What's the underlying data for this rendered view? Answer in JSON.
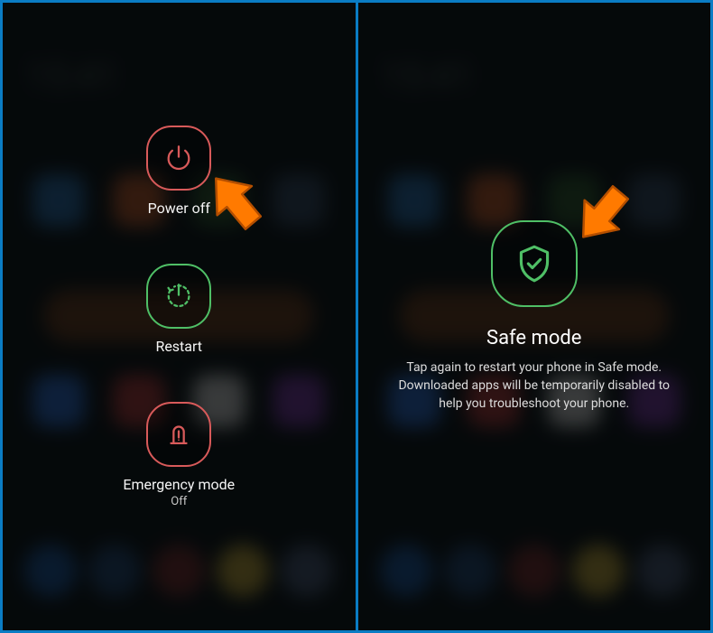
{
  "panel1": {
    "power_off": {
      "label": "Power off"
    },
    "restart": {
      "label": "Restart"
    },
    "emergency": {
      "label": "Emergency mode",
      "sublabel": "Off"
    }
  },
  "panel2": {
    "safe_mode": {
      "title": "Safe mode",
      "desc": "Tap again to restart your phone in Safe mode. Downloaded apps will be temporarily disabled to help you troubleshoot your phone."
    }
  },
  "bg_clock": "15:41",
  "colors": {
    "frame": "#0a7cc4",
    "red": "#d85a5a",
    "green": "#4fbf66",
    "arrow": "#ff7a00"
  }
}
